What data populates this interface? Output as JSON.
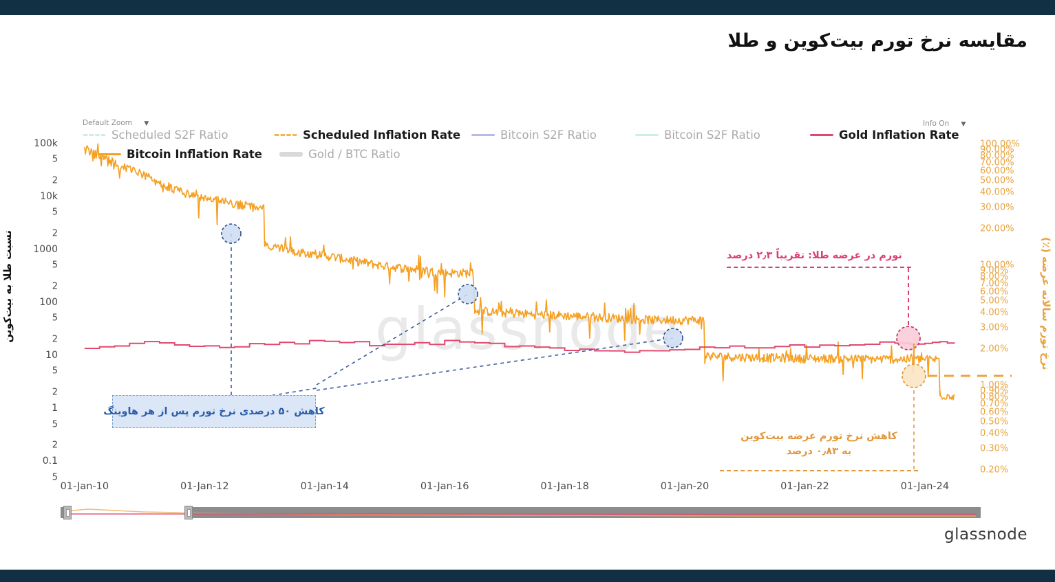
{
  "header": {
    "title": "مقایسه نرخ تورم بیت‌کوین و طلا"
  },
  "controls": {
    "zoom_label": "Default Zoom",
    "zoom_caret": "▼",
    "info_label": "Info On",
    "info_caret": "▼"
  },
  "brand": {
    "watermark": "glassnode",
    "logo": "glassnode"
  },
  "axes": {
    "left_title": "نسبت طلا به بیت‌کوین",
    "right_title": "نرخ تورم سالانه عرضه (٪)"
  },
  "annotations": {
    "halving": "کاهش ۵۰ درصدی نرخ تورم پس از هر هاوینگ",
    "gold": "تورم در عرضه طلا: تقریباً ۲٫۳ درصد",
    "bitcoin_line1": "کاهش نرخ تورم عرضه بیت‌کوین",
    "bitcoin_line2": "به ۰٫۸۳ درصد"
  },
  "colors": {
    "orange": "#f5a023",
    "pink": "#e0496f",
    "blue": "#2a5caa",
    "gray": "#d9d9d9",
    "lavender": "#b9b9e8",
    "mint": "#cdeee4",
    "topbar": "#123044"
  },
  "legend": [
    {
      "label": "Scheduled S2F Ratio",
      "color": "#cdeee4",
      "style": "dashed",
      "emphasis": "dim"
    },
    {
      "label": "Scheduled Inflation Rate",
      "color": "#f0b84c",
      "style": "dashed",
      "emphasis": "strong"
    },
    {
      "label": "Bitcoin S2F Ratio",
      "color": "#b9b9e8",
      "style": "solid",
      "emphasis": "dim"
    },
    {
      "label": "Bitcoin S2F Ratio",
      "color": "#cdeee4",
      "style": "solid",
      "emphasis": "dim"
    },
    {
      "label": "Gold Inflation Rate",
      "color": "#e0496f",
      "style": "solid",
      "emphasis": "strong"
    },
    {
      "label": "Bitcoin Inflation Rate",
      "color": "#f5a023",
      "style": "solid",
      "emphasis": "strong"
    },
    {
      "label": "Gold / BTC Ratio",
      "color": "#d9d9d9",
      "style": "thick",
      "emphasis": "dim"
    }
  ],
  "chart_data": {
    "type": "line",
    "title": "مقایسه نرخ تورم بیت‌کوین و طلا",
    "xlabel": "",
    "ylabel": "نسبت طلا به بیت‌کوین",
    "y2label": "نرخ تورم سالانه عرضه (٪)",
    "grid": false,
    "legend_position": "top",
    "x_ticks": [
      "01-Jan-10",
      "01-Jan-12",
      "01-Jan-14",
      "01-Jan-16",
      "01-Jan-18",
      "01-Jan-20",
      "01-Jan-22",
      "01-Jan-24"
    ],
    "y_left_scale": "log",
    "y_left_ticks": [
      "100k",
      "5",
      "2",
      "10k",
      "5",
      "2",
      "1000",
      "5",
      "2",
      "100",
      "5",
      "2",
      "10",
      "5",
      "2",
      "1",
      "5",
      "2",
      "0.1",
      "5"
    ],
    "y_left_range": [
      0.05,
      200000
    ],
    "y_right_scale": "log",
    "y_right_ticks": [
      "100.00%",
      "90.00%",
      "80.00%",
      "70.00%",
      "60.00%",
      "50.00%",
      "40.00%",
      "30.00%",
      "20.00%",
      "10.00%",
      "9.00%",
      "8.00%",
      "7.00%",
      "6.00%",
      "5.00%",
      "4.00%",
      "3.00%",
      "2.00%",
      "1.00%",
      "0.90%",
      "0.80%",
      "0.70%",
      "0.60%",
      "0.50%",
      "0.40%",
      "0.30%",
      "0.20%"
    ],
    "y_right_range": [
      0.18,
      120
    ],
    "series": [
      {
        "name": "Bitcoin Inflation Rate",
        "color": "#f5a023",
        "axis": "right",
        "unit": "%",
        "x": [
          "2010-01",
          "2010-07",
          "2011-01",
          "2011-07",
          "2012-01",
          "2012-07",
          "2012-11",
          "2013-01",
          "2013-07",
          "2014-01",
          "2014-07",
          "2015-01",
          "2015-07",
          "2016-01",
          "2016-07",
          "2017-01",
          "2017-07",
          "2018-01",
          "2018-07",
          "2019-01",
          "2019-07",
          "2020-01",
          "2020-05",
          "2020-07",
          "2021-01",
          "2021-07",
          "2022-01",
          "2022-07",
          "2023-01",
          "2023-07",
          "2024-01",
          "2024-04",
          "2024-07"
        ],
        "values": [
          90,
          70,
          55,
          42,
          36,
          32,
          30,
          14.5,
          13.0,
          12.0,
          10.8,
          9.8,
          9.2,
          8.6,
          4.2,
          4.0,
          3.9,
          3.8,
          3.7,
          3.6,
          3.5,
          3.5,
          1.78,
          1.75,
          1.72,
          1.7,
          1.68,
          1.68,
          1.66,
          1.66,
          1.65,
          0.83,
          0.83
        ]
      },
      {
        "name": "Gold Inflation Rate",
        "color": "#e0496f",
        "axis": "right",
        "unit": "%",
        "x": [
          "2010-01",
          "2011-01",
          "2012-01",
          "2013-01",
          "2014-01",
          "2015-01",
          "2016-01",
          "2017-01",
          "2018-01",
          "2019-01",
          "2020-01",
          "2021-01",
          "2022-01",
          "2023-01",
          "2024-01",
          "2024-07"
        ],
        "values": [
          2.05,
          2.25,
          2.1,
          2.2,
          2.35,
          2.15,
          2.3,
          2.15,
          1.95,
          1.9,
          2.05,
          2.1,
          2.15,
          2.2,
          2.3,
          2.3
        ]
      }
    ],
    "markers": [
      {
        "name": "halving-2012",
        "date": "2012-11-28",
        "color": "#2a5caa"
      },
      {
        "name": "halving-2016",
        "date": "2016-07-09",
        "color": "#2a5caa"
      },
      {
        "name": "halving-2020",
        "date": "2020-05-11",
        "color": "#2a5caa"
      },
      {
        "name": "gold-rate-2024",
        "date": "2024-04",
        "value": "2.3%",
        "color": "#e0496f"
      },
      {
        "name": "btc-rate-2024",
        "date": "2024-04",
        "value": "0.83%",
        "color": "#f5a023"
      }
    ],
    "callouts": [
      {
        "text": "کاهش ۵۰ درصدی نرخ تورم پس از هر هاوینگ",
        "color": "#2a5caa"
      },
      {
        "text": "تورم در عرضه طلا: تقریباً ۲٫۳ درصد",
        "color": "#e0496f"
      },
      {
        "text": "کاهش نرخ تورم عرضه بیت‌کوین به ۰٫۸۳ درصد",
        "color": "#e2973a"
      }
    ]
  }
}
